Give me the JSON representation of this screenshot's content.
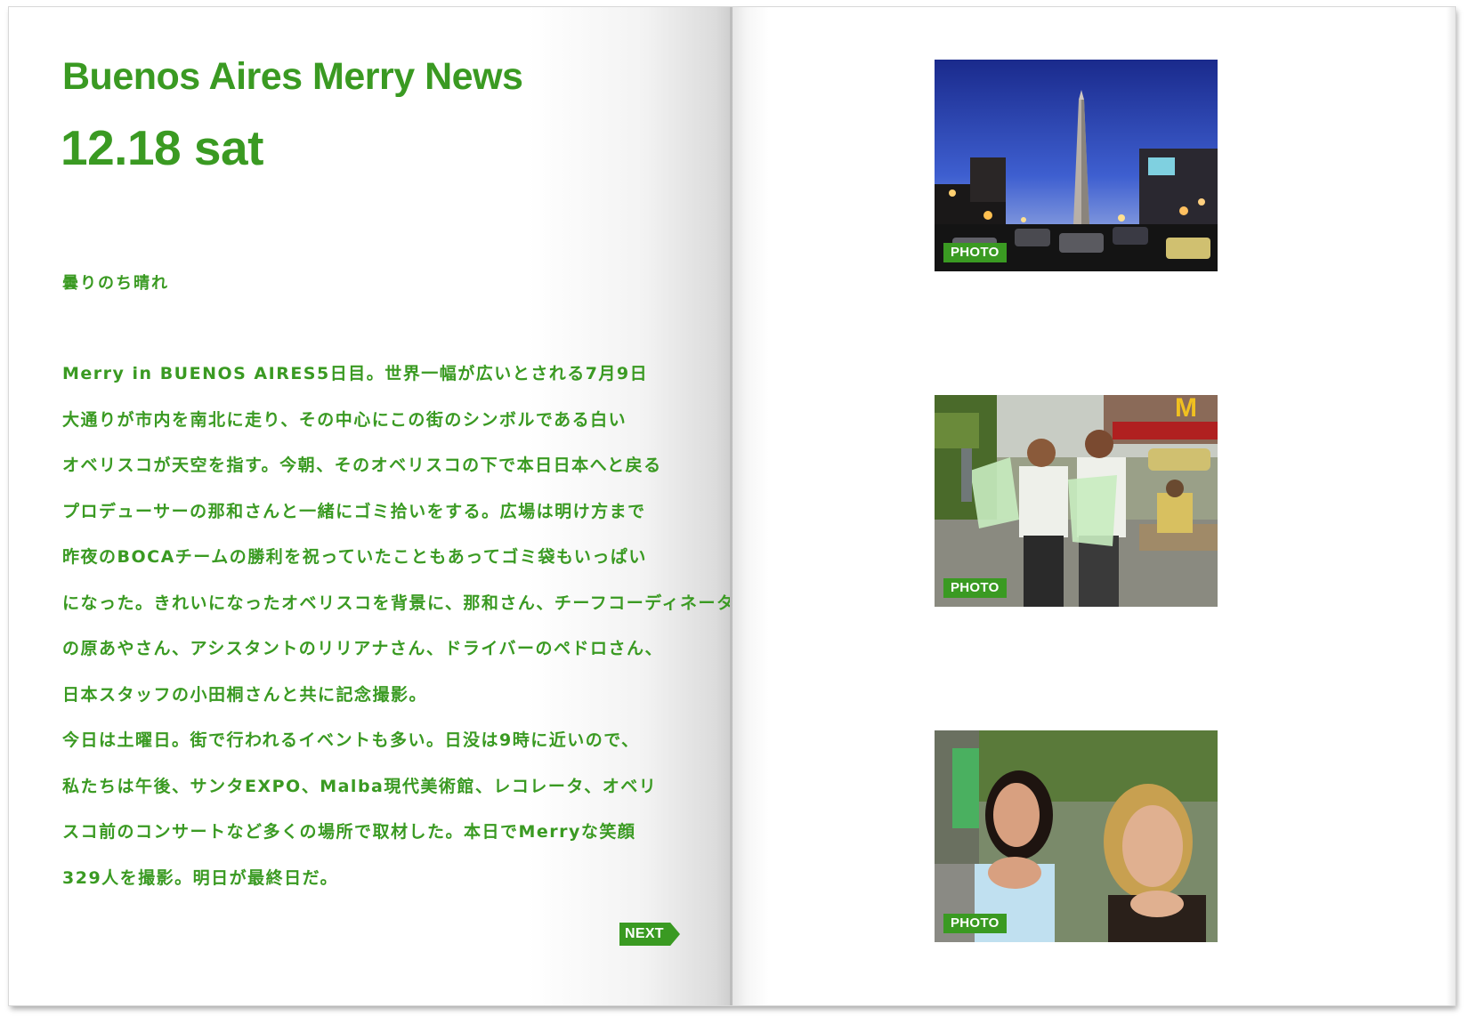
{
  "header": {
    "title": "Buenos Aires Merry News",
    "date": "12.18 sat"
  },
  "weather": "曇りのち晴れ",
  "body_lines": [
    "Merry in BUENOS AIRES5日目。世界一幅が広いとされる7月9日",
    "大通りが市内を南北に走り、その中心にこの街のシンボルである白い",
    "オベリスコが天空を指す。今朝、そのオベリスコの下で本日日本へと戻る",
    "プロデューサーの那和さんと一緒にゴミ拾いをする。広場は明け方まで",
    "昨夜のBOCAチームの勝利を祝っていたこともあってゴミ袋もいっぱい",
    "になった。きれいになったオベリスコを背景に、那和さん、チーフコーディネーター",
    "の原あやさん、アシスタントのリリアナさん、ドライバーのペドロさん、",
    "日本スタッフの小田桐さんと共に記念撮影。",
    "今日は土曜日。街で行われるイベントも多い。日没は9時に近いので、",
    "私たちは午後、サンタEXPO、Malba現代美術館、レコレータ、オベリ",
    "スコ前のコンサートなど多くの場所で取材した。本日でMerryな笑顔",
    "329人を撮影。明日が最終日だ。"
  ],
  "next_label": "NEXT",
  "photos": [
    {
      "badge": "PHOTO"
    },
    {
      "badge": "PHOTO"
    },
    {
      "badge": "PHOTO"
    }
  ],
  "colors": {
    "accent": "#3a9a22"
  }
}
